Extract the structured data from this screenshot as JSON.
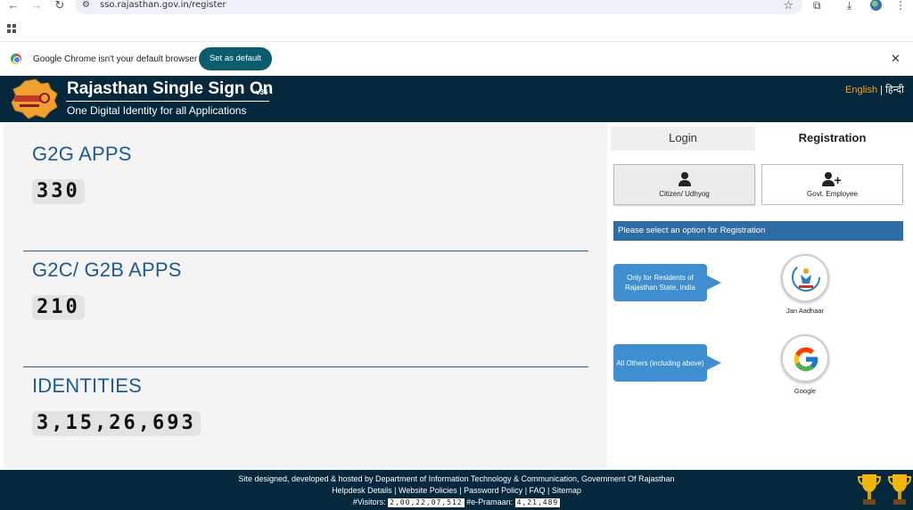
{
  "browser": {
    "url": "sso.rajasthan.gov.in/register",
    "infobar_text": "Google Chrome isn't your default browser",
    "set_default_label": "Set as default"
  },
  "header": {
    "title": "Rajasthan Single Sign On",
    "version": "v36",
    "subtitle": "One Digital Identity for all Applications",
    "lang_en": "English",
    "lang_sep": "|",
    "lang_hi": "हिन्दी"
  },
  "stats": [
    {
      "title": "G2G APPS",
      "value": "330"
    },
    {
      "title": "G2C/ G2B APPS",
      "value": "210"
    },
    {
      "title": "IDENTITIES",
      "value": "3,15,26,693"
    }
  ],
  "tabs": {
    "login": "Login",
    "registration": "Registration"
  },
  "options": {
    "citizen": "Citizen/ Udhyog",
    "gov": "Govt. Employee"
  },
  "notice": "Please select an option for Registration",
  "providers": [
    {
      "callout": "Only for Residents of Rajasthan State, India",
      "caption": "Jan Aadhaar",
      "icon": "jan-aadhaar-logo"
    },
    {
      "callout": "All Others (including above)",
      "caption": "Google",
      "icon": "google-logo"
    }
  ],
  "footer": {
    "line1": "Site designed, developed & hosted by Department of Information Technology & Communication, Government Of Rajasthan",
    "links": [
      "Helpdesk Details",
      "Website Policies",
      "Password Policy",
      "FAQ",
      "Sitemap"
    ],
    "visitors_label": "#Visitors:",
    "visitors_value": "2,00,22,07,512",
    "epramaan_label": "#e-Pramaan:",
    "epramaan_value": "4,21,489"
  },
  "colors": {
    "header_bg": "#06283d",
    "stat_title": "#1e5a92",
    "accent_button": "#0b5d6e",
    "lang_active": "#f7a21b",
    "notice_bg": "#2e6da4",
    "callout_bg": "#3e8ed0"
  }
}
